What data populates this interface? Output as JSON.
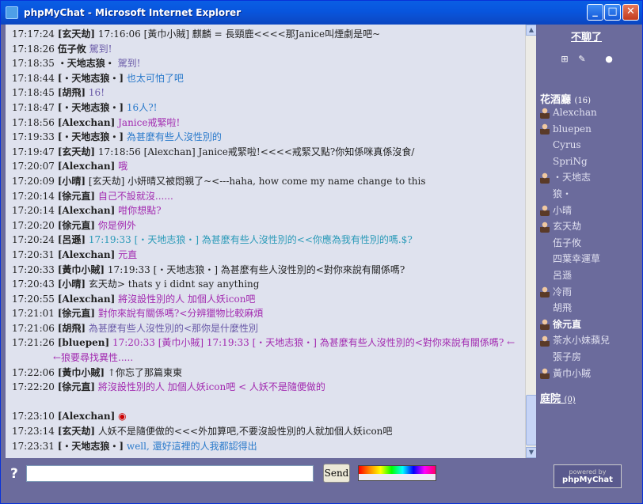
{
  "window": {
    "title": "phpMyChat - Microsoft Internet Explorer"
  },
  "sidebar": {
    "exit_label": "不聊了",
    "room1": {
      "name": "花酒廳",
      "count": "(16)"
    },
    "users": [
      {
        "name": "Alexchan",
        "icon": "user-icon",
        "bold": false
      },
      {
        "name": "bluepen",
        "icon": "user-icon",
        "bold": false
      },
      {
        "name": "Cyrus",
        "icon": "",
        "bold": false
      },
      {
        "name": "SpriNg",
        "icon": "",
        "bold": false
      },
      {
        "name": "・天地志",
        "icon": "wolf-icon",
        "bold": false
      },
      {
        "name": "狼・",
        "icon": "",
        "bold": false
      },
      {
        "name": "小晴",
        "icon": "girl-icon",
        "bold": false
      },
      {
        "name": "玄天劫",
        "icon": "user-icon",
        "bold": false
      },
      {
        "name": "伍子攸",
        "icon": "",
        "bold": false
      },
      {
        "name": "四葉幸運草",
        "icon": "",
        "bold": false
      },
      {
        "name": "呂遜",
        "icon": "",
        "bold": false
      },
      {
        "name": "冷雨",
        "icon": "user-icon",
        "bold": false
      },
      {
        "name": "胡飛",
        "icon": "",
        "bold": false
      },
      {
        "name": "徐元直",
        "icon": "user-icon",
        "bold": true
      },
      {
        "name": "茶水小妹蘋兒",
        "icon": "user-icon",
        "bold": false
      },
      {
        "name": "張子房",
        "icon": "",
        "bold": false
      },
      {
        "name": "黃巾小賊",
        "icon": "user-icon",
        "bold": false
      }
    ],
    "room2": {
      "name": "庭院",
      "count": "(0)"
    }
  },
  "messages": [
    {
      "time": "17:17:24",
      "name": "[玄天劫]",
      "text": "17:16:06 [黃巾小賊] 麒麟 = 長頸鹿<<<<那Janice叫煙劇是吧~",
      "color": "#222222"
    },
    {
      "time": "17:18:26",
      "name": "伍子攸",
      "text": "駕到!",
      "color": "#6a5aa8"
    },
    {
      "time": "17:18:35",
      "name": "・天地志狼・",
      "text": "駕到!",
      "color": "#6a5aa8"
    },
    {
      "time": "17:18:44",
      "name": "[・天地志狼・]",
      "text": "也太可怕了吧",
      "color": "#2a7acb"
    },
    {
      "time": "17:18:45",
      "name": "[胡飛]",
      "text": "16!",
      "color": "#6a5aa8"
    },
    {
      "time": "17:18:47",
      "name": "[・天地志狼・]",
      "text": "16人?!",
      "color": "#2a7acb"
    },
    {
      "time": "17:18:56",
      "name": "[Alexchan]",
      "text": "Janice戒緊啦!",
      "color": "#a22ab0"
    },
    {
      "time": "17:19:33",
      "name": "[・天地志狼・]",
      "text": "為甚麼有些人沒性別的",
      "color": "#2a7acb"
    },
    {
      "time": "17:19:47",
      "name": "[玄天劫]",
      "text": "17:18:56 [Alexchan] Janice戒緊啦!<<<<戒緊又點?你知係咪真係沒食/",
      "color": "#222222"
    },
    {
      "time": "17:20:07",
      "name": "[Alexchan]",
      "text": "哦",
      "color": "#a22ab0"
    },
    {
      "time": "17:20:09",
      "name": "[小晴]",
      "text": "[玄天劫] 小妍晴又被悶親了~<---haha, how come my name change to this",
      "color": "#222222"
    },
    {
      "time": "17:20:14",
      "name": "[徐元直]",
      "text": "自己不設就沒......",
      "color": "#a22ab0"
    },
    {
      "time": "17:20:14",
      "name": "[Alexchan]",
      "text": "咁你想點?",
      "color": "#a22ab0"
    },
    {
      "time": "17:20:20",
      "name": "[徐元直]",
      "text": "你是例外",
      "color": "#a22ab0"
    },
    {
      "time": "17:20:24",
      "name": "[呂遜]",
      "text": "17:19:33 [・天地志狼・] 為甚麼有些人沒性別的<<你應為我有性別的嗎.$?",
      "color": "#2a9ab8"
    },
    {
      "time": "17:20:31",
      "name": "[Alexchan]",
      "text": "元直",
      "color": "#a22ab0"
    },
    {
      "time": "17:20:33",
      "name": "[黃巾小賊]",
      "text": "17:19:33 [・天地志狼・] 為甚麼有些人沒性別的<對你來說有關係嗎?",
      "color": "#222222"
    },
    {
      "time": "17:20:43",
      "name": "[小晴]",
      "text": "玄天劫> thats y i didnt say anything",
      "color": "#222222"
    },
    {
      "time": "17:20:55",
      "name": "[Alexchan]",
      "text": "將沒設性別的人  加個人妖icon吧",
      "color": "#a22ab0"
    },
    {
      "time": "17:21:01",
      "name": "[徐元直]",
      "text": "對你來說有關係嗎?<分辨獵物比較麻煩",
      "color": "#a22ab0"
    },
    {
      "time": "17:21:06",
      "name": "[胡飛]",
      "text": "為甚麼有些人沒性別的<那你是什麼性別",
      "color": "#6a5aa8"
    },
    {
      "time": "17:21:26",
      "name": "[bluepen]",
      "text": "17:20:33 [黃巾小賊] 17:19:33 [・天地志狼・] 為甚麼有些人沒性別的<對你來說有關係嗎?    ←",
      "color": "#a22ab0"
    },
    {
      "time": "",
      "name": "",
      "text": "←狼要尋找異性.....",
      "color": "#a22ab0"
    },
    {
      "time": "17:22:06",
      "name": "[黃巾小賊]",
      "text": "↑你忘了那篇東東",
      "color": "#222222"
    },
    {
      "time": "17:22:20",
      "name": "[徐元直]",
      "text": "將沒設性別的人  加個人妖icon吧 < 人妖不是隨便做的",
      "color": "#a22ab0"
    },
    {
      "time": "",
      "name": "",
      "text": "",
      "color": "#222222"
    },
    {
      "time": "17:23:10",
      "name": "[Alexchan]",
      "text": "",
      "color": "#222222"
    },
    {
      "time": "17:23:14",
      "name": "[玄天劫]",
      "text": "人妖不是隨便做的<<<外加算吧,不要沒設性別的人就加個人妖icon吧",
      "color": "#222222"
    },
    {
      "time": "17:23:31",
      "name": "[・天地志狼・]",
      "text": "well, 還好這裡的人我都認得出",
      "color": "#2a7acb"
    }
  ],
  "footer": {
    "help": "?",
    "send_label": "Send",
    "logo_small": "powered by",
    "logo_text": "phpMyChat"
  }
}
